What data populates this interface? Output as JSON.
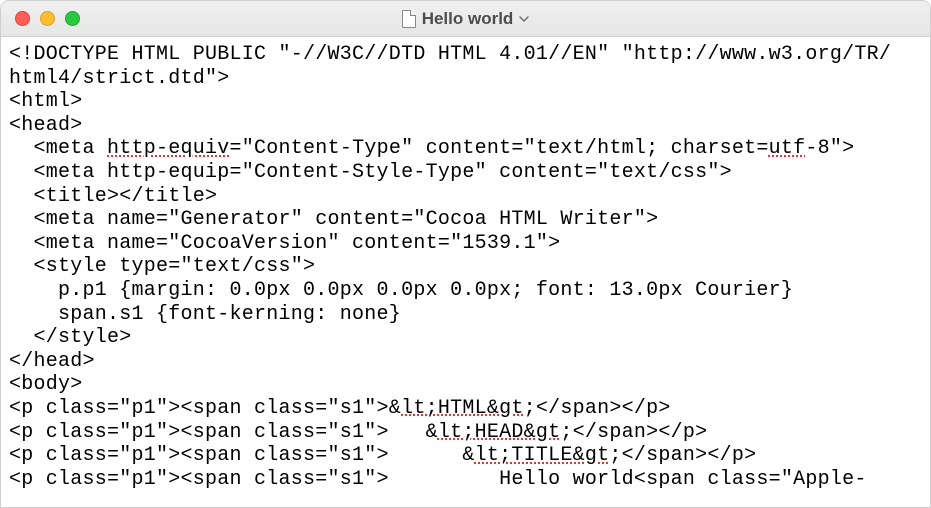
{
  "window": {
    "title": "Hello world"
  },
  "spellcheck_words": [
    "http-equiv",
    "utf",
    "lt;HTML&gt",
    "lt;HEAD&gt",
    "lt;TITLE&gt"
  ],
  "lines": [
    "<!DOCTYPE HTML PUBLIC \"-//W3C//DTD HTML 4.01//EN\" \"http://www.w3.org/TR/",
    "html4/strict.dtd\">",
    "<html>",
    "<head>",
    "  <meta http-equiv=\"Content-Type\" content=\"text/html; charset=utf-8\">",
    "  <meta http-equip=\"Content-Style-Type\" content=\"text/css\">",
    "  <title></title>",
    "  <meta name=\"Generator\" content=\"Cocoa HTML Writer\">",
    "  <meta name=\"CocoaVersion\" content=\"1539.1\">",
    "  <style type=\"text/css\">",
    "    p.p1 {margin: 0.0px 0.0px 0.0px 0.0px; font: 13.0px Courier}",
    "    span.s1 {font-kerning: none}",
    "  </style>",
    "</head>",
    "<body>",
    "<p class=\"p1\"><span class=\"s1\">&lt;HTML&gt;</span></p>",
    "<p class=\"p1\"><span class=\"s1\">   &lt;HEAD&gt;</span></p>",
    "<p class=\"p1\"><span class=\"s1\">      &lt;TITLE&gt;</span></p>",
    "<p class=\"p1\"><span class=\"s1\">         Hello world<span class=\"Apple-"
  ]
}
